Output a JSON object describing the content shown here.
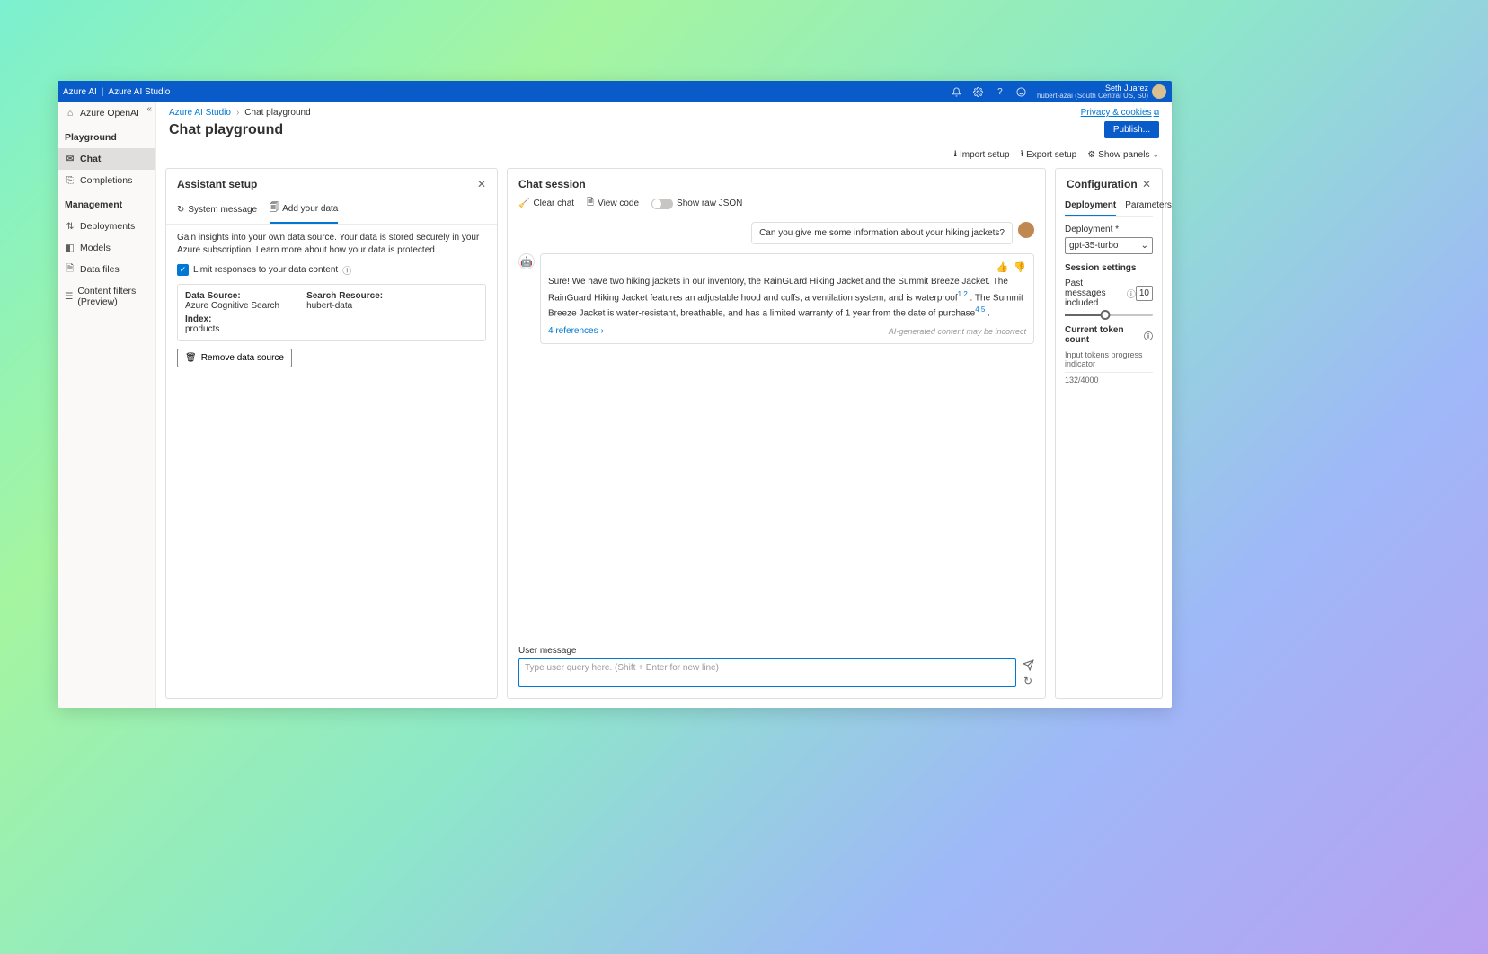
{
  "topbar": {
    "brand1": "Azure AI",
    "brand2": "Azure AI Studio",
    "user_name": "Seth Juarez",
    "user_sub": "hubert-azai (South Central US, S0)"
  },
  "sidebar": {
    "item_azure_openai": "Azure OpenAI",
    "header_playground": "Playground",
    "item_chat": "Chat",
    "item_completions": "Completions",
    "header_management": "Management",
    "item_deployments": "Deployments",
    "item_models": "Models",
    "item_data_files": "Data files",
    "item_content_filters": "Content filters (Preview)"
  },
  "breadcrumb": {
    "root": "Azure AI Studio",
    "current": "Chat playground",
    "privacy": "Privacy & cookies"
  },
  "page_title": "Chat playground",
  "toolbar": {
    "publish": "Publish...",
    "import_setup": "Import setup",
    "export_setup": "Export setup",
    "show_panels": "Show panels"
  },
  "assist": {
    "title": "Assistant setup",
    "tab_system": "System message",
    "tab_add_data": "Add your data",
    "desc": "Gain insights into your own data source. Your data is stored securely in your Azure subscription. Learn more about how your data is protected",
    "limit_label": "Limit responses to your data content",
    "ds_label": "Data Source:",
    "ds_value": "Azure Cognitive Search",
    "sr_label": "Search Resource:",
    "sr_value": "hubert-data",
    "idx_label": "Index:",
    "idx_value": "products",
    "remove_btn": "Remove data source"
  },
  "chat": {
    "title": "Chat session",
    "clear": "Clear chat",
    "view_code": "View code",
    "show_raw": "Show raw JSON",
    "user_msg": "Can you give me some information about your hiking jackets?",
    "ai_text_1": "Sure! We have two hiking jackets in our inventory, the RainGuard Hiking Jacket and the Summit Breeze Jacket. The RainGuard Hiking Jacket features an adjustable hood and cuffs, a ventilation system, and is waterproof",
    "ai_sup_1": "1 2",
    "ai_text_2": " . The Summit Breeze Jacket is water-resistant, breathable, and has a limited warranty of 1 year from the date of purchase",
    "ai_sup_2": "4 5",
    "ai_text_3": " .",
    "refs": "4 references",
    "disclaimer": "AI-generated content may be incorrect",
    "um_label": "User message",
    "placeholder": "Type user query here. (Shift + Enter for new line)"
  },
  "config": {
    "title": "Configuration",
    "tab_deployment": "Deployment",
    "tab_parameters": "Parameters",
    "deploy_label": "Deployment *",
    "deploy_value": "gpt-35-turbo",
    "session_title": "Session settings",
    "past_label": "Past messages included",
    "past_value": "10",
    "token_title": "Current token count",
    "token_hint": "Input tokens progress indicator",
    "token_value": "132/4000"
  }
}
